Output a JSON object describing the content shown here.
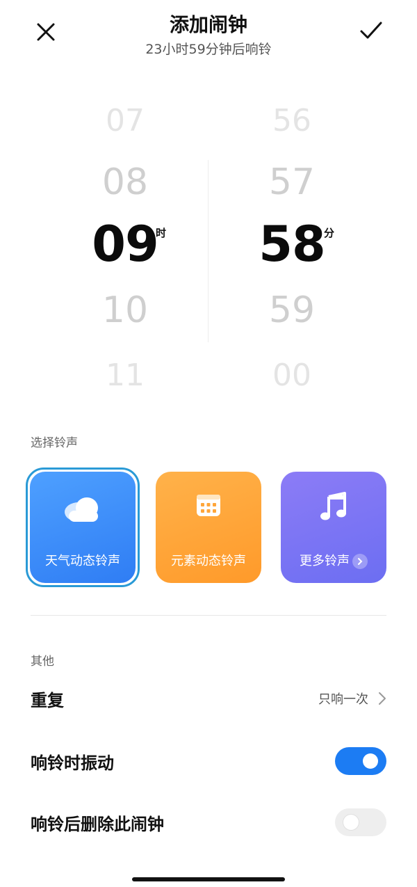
{
  "header": {
    "title": "添加闹钟",
    "subtitle": "23小时59分钟后响铃",
    "close_icon": "close-icon",
    "confirm_icon": "checkmark-icon"
  },
  "picker": {
    "hours": [
      "07",
      "08",
      "09",
      "10",
      "11"
    ],
    "minutes": [
      "56",
      "57",
      "58",
      "59",
      "00"
    ],
    "selected_hour": "09",
    "selected_minute": "58",
    "hour_unit": "时",
    "minute_unit": "分"
  },
  "ringtone": {
    "section_label": "选择铃声",
    "options": [
      {
        "label": "天气动态铃声",
        "icon": "cloud-icon",
        "color": "#3a8bf8",
        "selected": true
      },
      {
        "label": "元素动态铃声",
        "icon": "calendar-grid-icon",
        "color": "#ffa63a",
        "selected": false
      },
      {
        "label": "更多铃声",
        "icon": "music-note-icon",
        "color": "#7a74f4",
        "selected": false
      }
    ]
  },
  "other": {
    "section_label": "其他",
    "repeat": {
      "label": "重复",
      "value": "只响一次"
    },
    "vibrate": {
      "label": "响铃时振动",
      "enabled": true
    },
    "delete_after": {
      "label": "响铃后删除此闹钟",
      "enabled": false
    }
  },
  "colors": {
    "accent": "#1c7cf3",
    "selection_ring": "#2a9ad6"
  }
}
